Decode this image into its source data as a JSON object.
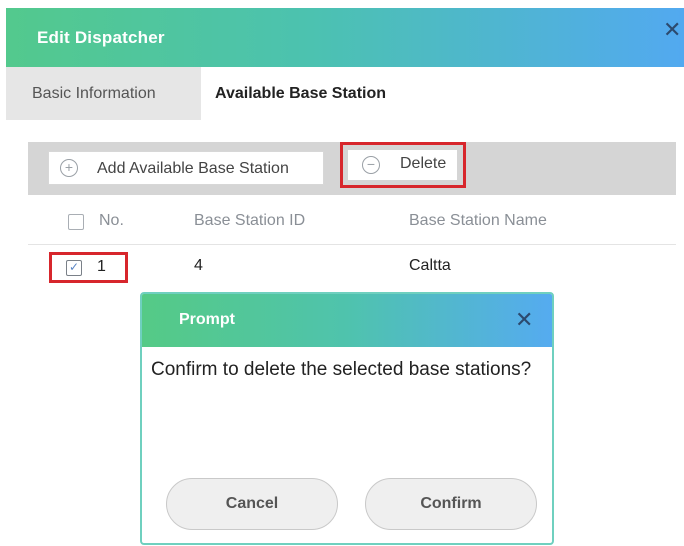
{
  "dialog": {
    "title": "Edit Dispatcher",
    "close_glyph": "✕"
  },
  "tabs": [
    {
      "label": "Basic Information",
      "active": false
    },
    {
      "label": "Available Base Station",
      "active": true
    }
  ],
  "toolbar": {
    "add_label": "Add Available Base Station",
    "add_icon": "plus-circle-icon",
    "add_glyph": "+",
    "delete_label": "Delete",
    "delete_icon": "minus-circle-icon",
    "delete_glyph": "−"
  },
  "table": {
    "columns": [
      "No.",
      "Base Station ID",
      "Base Station Name"
    ],
    "rows": [
      {
        "no": "1",
        "id": "4",
        "name": "Caltta",
        "checked": true,
        "check_glyph": "✓"
      }
    ]
  },
  "prompt": {
    "title": "Prompt",
    "close_glyph": "✕",
    "message": "Confirm to delete the selected base stations?",
    "cancel_label": "Cancel",
    "confirm_label": "Confirm"
  },
  "colors": {
    "header_gradient_start": "#53c98d",
    "header_gradient_end": "#52a9f0",
    "highlight_red": "#d7262c"
  }
}
